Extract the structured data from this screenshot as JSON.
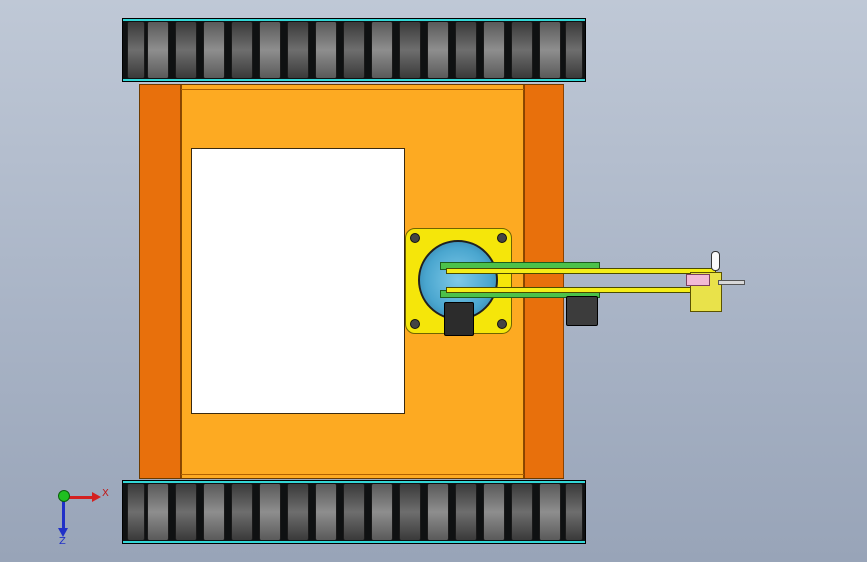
{
  "view": {
    "background_top": "#bfc8d6",
    "background_bottom": "#98a4b8"
  },
  "model": {
    "body_color": "#fdaa22",
    "rail_color": "#e8700c",
    "track_color": "#111111",
    "motor_plate_color": "#f5e60a",
    "arm_color": "#f5ee18",
    "belt_color": "#4cc14a"
  },
  "triad": {
    "x_label": "X",
    "z_label": "Z",
    "x_color": "#d42020",
    "z_color": "#2030c8",
    "origin_color": "#20c020"
  }
}
